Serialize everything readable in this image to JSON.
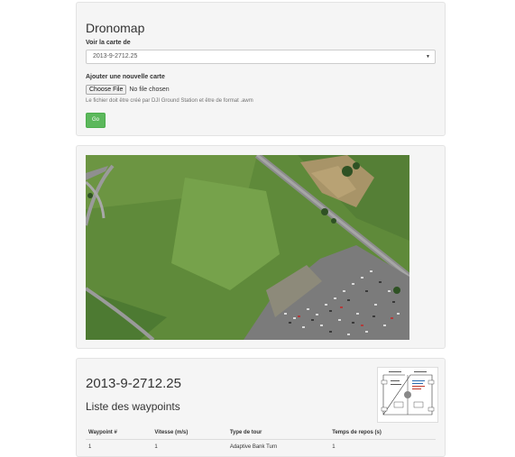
{
  "app": {
    "title": "Dronomap"
  },
  "form": {
    "view_map_label": "Voir la carte de",
    "selected_map": "2013-9-2712.25",
    "add_map_label": "Ajouter une nouvelle carte",
    "choose_file_label": "Choose File",
    "file_status": "No file chosen",
    "help_text": "Le fichier doit être créé par DJI Ground Station et être de format .awm",
    "go_label": "Go"
  },
  "colors": {
    "go_button": "#5cb85c",
    "panel_bg": "#f5f5f5"
  },
  "details": {
    "title": "2013-9-2712.25",
    "waypoints_heading": "Liste des waypoints",
    "table": {
      "headers": [
        "Waypoint #",
        "Vitesse (m/s)",
        "Type de tour",
        "Temps de repos (s)"
      ],
      "rows": [
        [
          "1",
          "1",
          "Adaptive Bank Turn",
          "1"
        ]
      ]
    }
  },
  "icons": {
    "select_caret": "caret-down-icon"
  }
}
